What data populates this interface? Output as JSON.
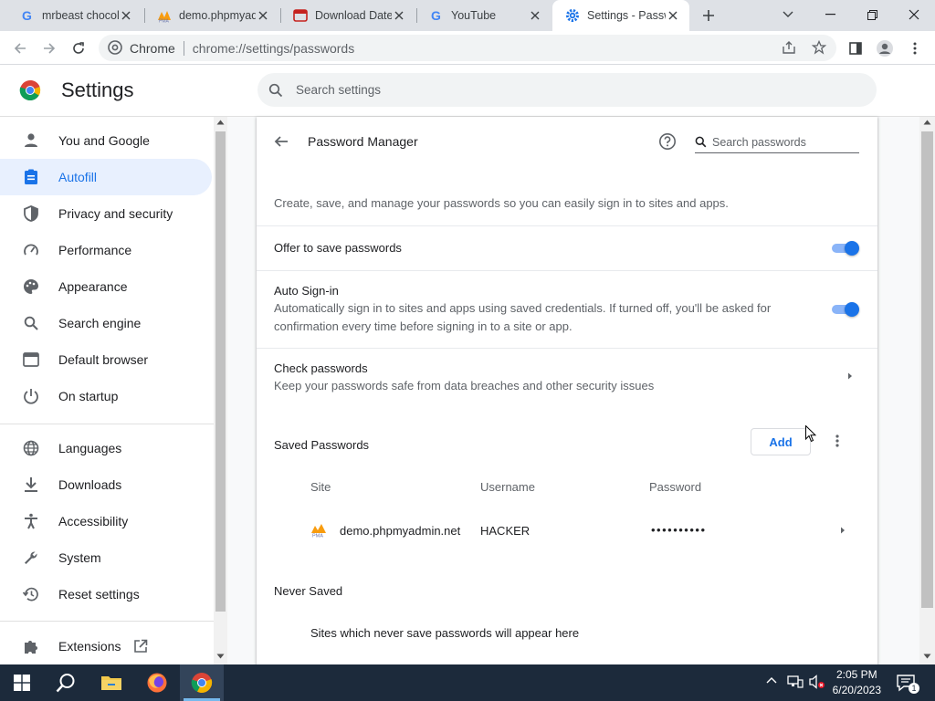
{
  "browser": {
    "tabs": [
      {
        "title": "mrbeast chocola",
        "favicon": "google-g-icon",
        "active": false
      },
      {
        "title": "demo.phpmyadm",
        "favicon": "phpmyadmin-icon",
        "active": false
      },
      {
        "title": "Download Date",
        "favicon": "page-icon",
        "active": false
      },
      {
        "title": "YouTube",
        "favicon": "google-g-icon",
        "active": false
      },
      {
        "title": "Settings - Passw",
        "favicon": "settings-gear-icon",
        "active": true
      }
    ],
    "omnibox": {
      "site_label": "Chrome",
      "url": "chrome://settings/passwords"
    }
  },
  "settings": {
    "title": "Settings",
    "search_placeholder": "Search settings",
    "nav": [
      {
        "label": "You and Google",
        "icon": "person-icon"
      },
      {
        "label": "Autofill",
        "icon": "clipboard-icon",
        "active": true
      },
      {
        "label": "Privacy and security",
        "icon": "shield-icon"
      },
      {
        "label": "Performance",
        "icon": "speedometer-icon"
      },
      {
        "label": "Appearance",
        "icon": "palette-icon"
      },
      {
        "label": "Search engine",
        "icon": "search-icon"
      },
      {
        "label": "Default browser",
        "icon": "browser-window-icon"
      },
      {
        "label": "On startup",
        "icon": "power-icon"
      },
      {
        "label": "Languages",
        "icon": "globe-icon"
      },
      {
        "label": "Downloads",
        "icon": "download-icon"
      },
      {
        "label": "Accessibility",
        "icon": "accessibility-icon"
      },
      {
        "label": "System",
        "icon": "wrench-icon"
      },
      {
        "label": "Reset settings",
        "icon": "restore-icon"
      },
      {
        "label": "Extensions",
        "icon": "puzzle-icon"
      }
    ]
  },
  "password_manager": {
    "title": "Password Manager",
    "search_placeholder": "Search passwords",
    "description": "Create, save, and manage your passwords so you can easily sign in to sites and apps.",
    "offer_to_save": {
      "label": "Offer to save passwords",
      "enabled": true
    },
    "auto_signin": {
      "label": "Auto Sign-in",
      "description_line1": "Automatically sign in to sites and apps using saved credentials. If turned off, you'll be asked for",
      "description_line2": "confirmation every time before signing in to a site or app.",
      "enabled": true
    },
    "check_passwords": {
      "label": "Check passwords",
      "description": "Keep your passwords safe from data breaches and other security issues"
    },
    "saved": {
      "heading": "Saved Passwords",
      "add_label": "Add",
      "columns": {
        "site": "Site",
        "username": "Username",
        "password": "Password"
      },
      "rows": [
        {
          "site": "demo.phpmyadmin.net",
          "username": "HACKER",
          "password": "••••••••••"
        }
      ]
    },
    "never_saved": {
      "heading": "Never Saved",
      "empty_text": "Sites which never save passwords will appear here"
    }
  },
  "taskbar": {
    "time": "2:05 PM",
    "date": "6/20/2023",
    "notification_count": "1"
  },
  "colors": {
    "accent": "#1a73e8",
    "active_nav_bg": "#e8f0fe",
    "taskbar": "#1c2a3b"
  }
}
